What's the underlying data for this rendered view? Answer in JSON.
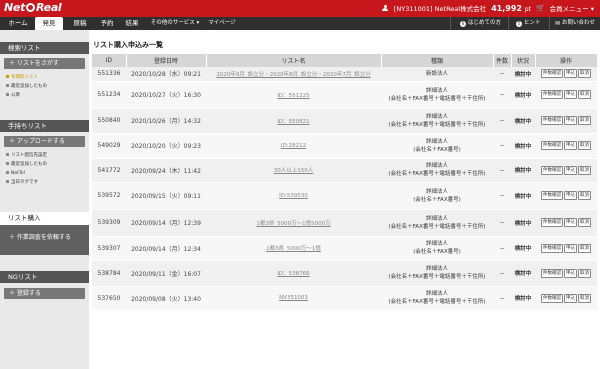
{
  "header": {
    "logo": "NetReal",
    "user": "[NY311001] NetReal株式会社",
    "points_value": "41,992",
    "points_unit": "pt",
    "cart_icon": "cart-icon",
    "member_menu": "会員メニュー ▾"
  },
  "nav": {
    "items": [
      "ホーム",
      "発見",
      "原稿",
      "予約",
      "結果"
    ],
    "other_services": "その他のサービス ▾",
    "mypage": "マイページ",
    "first_time": "はじめての方",
    "hint": "ヒント",
    "contact": "お問い合わせ"
  },
  "sidebar": {
    "search_list_head": "検索リスト",
    "make_list_btn": "＋ リストをさがす",
    "search_subs": [
      "有償取リスト",
      "最近追加したもの",
      "公衆"
    ],
    "handmade_head": "手持ちリスト",
    "upload_btn": "＋ アップロードする",
    "handmade_subs": [
      "リスト配信先設定",
      "最近追加したもの",
      "NetTel",
      "当日タグです"
    ],
    "list_purchase": "リスト購入",
    "add_work_btn": "＋ 作業調査を依頼する",
    "ng_head": "NGリスト",
    "register_btn": "＋ 登録する"
  },
  "main": {
    "title": "リスト購入申込み一覧",
    "columns": [
      "ID",
      "登録日時",
      "リスト名",
      "種類",
      "件数",
      "状況",
      "操作"
    ],
    "op_labels": [
      "件数確認",
      "申込",
      "取消"
    ],
    "rows": [
      {
        "id": "551336",
        "date": "2020/10/28（水）09:21",
        "name": "2020年9月_設立分・2020年8月_設立分・2020年7月_設立分",
        "kind1": "新設法人",
        "kind2": "",
        "count": "--",
        "status": "検討中"
      },
      {
        "id": "551234",
        "date": "2020/10/27（火）16:30",
        "name": "ID：551225",
        "kind1": "詳細法人",
        "kind2": "(会社名＋FAX番号＋電話番号＋〒住所)",
        "count": "--",
        "status": "検討中"
      },
      {
        "id": "550840",
        "date": "2020/10/26（月）14:32",
        "name": "ID：550821",
        "kind1": "詳細法人",
        "kind2": "(会社名＋FAX番号＋電話番号＋〒住所)",
        "count": "--",
        "status": "検討中"
      },
      {
        "id": "549029",
        "date": "2020/10/20（火）09:23",
        "name": "ID:28212",
        "kind1": "詳細法人",
        "kind2": "(会社名＋FAX番号)",
        "count": "--",
        "status": "検討中"
      },
      {
        "id": "541772",
        "date": "2020/09/24（木）11:42",
        "name": "30人以上150人",
        "kind1": "詳細法人",
        "kind2": "(会社名＋FAX番号＋電話番号＋〒住所)",
        "count": "--",
        "status": "検討中"
      },
      {
        "id": "539572",
        "date": "2020/09/15（火）09:11",
        "name": "ID:539530",
        "kind1": "詳細法人",
        "kind2": "(会社名＋FAX番号)",
        "count": "--",
        "status": "検討中"
      },
      {
        "id": "539309",
        "date": "2020/09/14（月）12:39",
        "name": "1都3県_5000万〜1億5000万",
        "kind1": "詳細法人",
        "kind2": "(会社名＋FAX番号＋電話番号＋〒住所)",
        "count": "--",
        "status": "検討中"
      },
      {
        "id": "539307",
        "date": "2020/09/14（月）12:34",
        "name": "1都3県_5000万〜1億",
        "kind1": "詳細法人",
        "kind2": "(会社名＋FAX番号)",
        "count": "--",
        "status": "検討中"
      },
      {
        "id": "538784",
        "date": "2020/09/11（金）16:07",
        "name": "ID：538766",
        "kind1": "詳細法人",
        "kind2": "(会社名＋FAX番号＋電話番号＋〒住所)",
        "count": "--",
        "status": "検討中"
      },
      {
        "id": "537650",
        "date": "2020/09/08（火）13:40",
        "name": "NV351003",
        "kind1": "詳細法人",
        "kind2": "(会社名＋FAX番号＋電話番号＋〒住所)",
        "count": "--",
        "status": "検討中"
      }
    ]
  }
}
